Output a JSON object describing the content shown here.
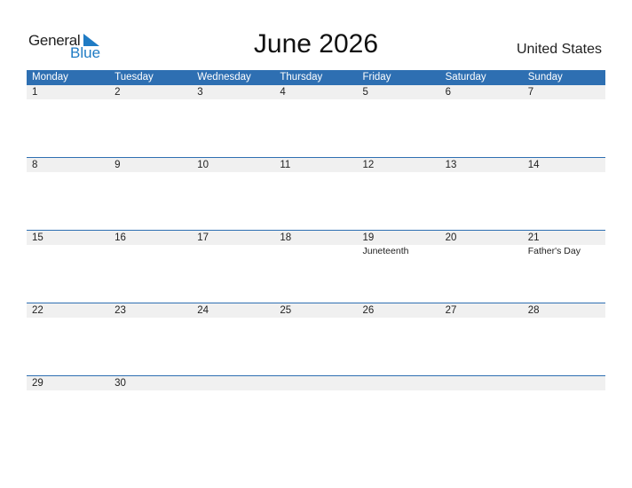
{
  "logo": {
    "part1": "General",
    "part2": "Blue"
  },
  "title": "June 2026",
  "country": "United States",
  "weekdays": [
    "Monday",
    "Tuesday",
    "Wednesday",
    "Thursday",
    "Friday",
    "Saturday",
    "Sunday"
  ],
  "weeks": [
    {
      "dates": [
        "1",
        "2",
        "3",
        "4",
        "5",
        "6",
        "7"
      ],
      "events": [
        "",
        "",
        "",
        "",
        "",
        "",
        ""
      ]
    },
    {
      "dates": [
        "8",
        "9",
        "10",
        "11",
        "12",
        "13",
        "14"
      ],
      "events": [
        "",
        "",
        "",
        "",
        "",
        "",
        ""
      ]
    },
    {
      "dates": [
        "15",
        "16",
        "17",
        "18",
        "19",
        "20",
        "21"
      ],
      "events": [
        "",
        "",
        "",
        "",
        "Juneteenth",
        "",
        "Father's Day"
      ]
    },
    {
      "dates": [
        "22",
        "23",
        "24",
        "25",
        "26",
        "27",
        "28"
      ],
      "events": [
        "",
        "",
        "",
        "",
        "",
        "",
        ""
      ]
    },
    {
      "dates": [
        "29",
        "30",
        "",
        "",
        "",
        "",
        ""
      ],
      "events": [
        "",
        "",
        "",
        "",
        "",
        "",
        ""
      ]
    }
  ],
  "colors": {
    "header": "#2e6fb2",
    "date_band": "#f0f0f0",
    "brand_blue": "#1f7bc4"
  }
}
